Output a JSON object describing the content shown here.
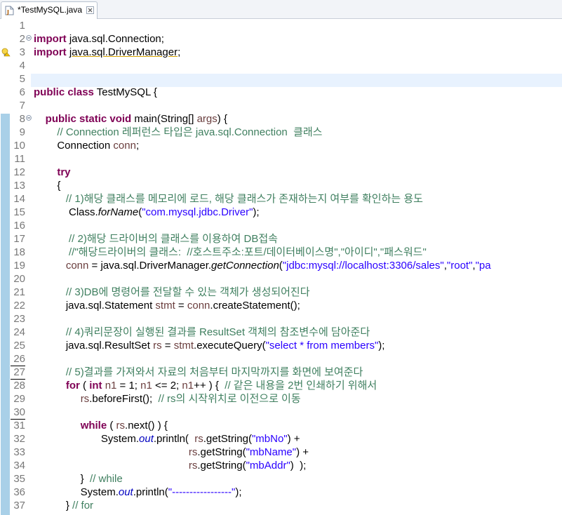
{
  "tab": {
    "label": "*TestMySQL.java",
    "icon": "java-file-icon",
    "close_icon": "close-icon"
  },
  "editor": {
    "lines": [
      {
        "no": "1"
      },
      {
        "no": "2",
        "fold": "minus",
        "segs": [
          [
            "kw",
            "import"
          ],
          [
            "n",
            " java.sql.Connection;"
          ]
        ]
      },
      {
        "no": "3",
        "warn": true,
        "segs": [
          [
            "kw",
            "import"
          ],
          [
            "n",
            " "
          ],
          [
            "ul",
            "java.sql.DriverManager"
          ],
          [
            "n",
            ";"
          ]
        ]
      },
      {
        "no": "4"
      },
      {
        "no": "5",
        "current": true
      },
      {
        "no": "6",
        "segs": [
          [
            "kw",
            "public"
          ],
          [
            "n",
            " "
          ],
          [
            "kw",
            "class"
          ],
          [
            "n",
            " TestMySQL {"
          ]
        ]
      },
      {
        "no": "7"
      },
      {
        "no": "8",
        "fold": "minus",
        "segs": [
          [
            "n",
            "    "
          ],
          [
            "kw",
            "public"
          ],
          [
            "n",
            " "
          ],
          [
            "kw",
            "static"
          ],
          [
            "n",
            " "
          ],
          [
            "kw",
            "void"
          ],
          [
            "n",
            " main(String[] "
          ],
          [
            "vr",
            "args"
          ],
          [
            "n",
            ") {"
          ]
        ]
      },
      {
        "no": "9",
        "segs": [
          [
            "n",
            "        "
          ],
          [
            "cm",
            "// Connection 레퍼런스 타입은 java.sql.Connection  클래스"
          ]
        ]
      },
      {
        "no": "10",
        "segs": [
          [
            "n",
            "        Connection "
          ],
          [
            "vr",
            "conn"
          ],
          [
            "n",
            ";"
          ]
        ]
      },
      {
        "no": "11"
      },
      {
        "no": "12",
        "segs": [
          [
            "n",
            "        "
          ],
          [
            "kw",
            "try"
          ]
        ]
      },
      {
        "no": "13",
        "segs": [
          [
            "n",
            "        {"
          ]
        ]
      },
      {
        "no": "14",
        "segs": [
          [
            "n",
            "           "
          ],
          [
            "cm",
            "// 1)해당 클래스를 메모리에 로드, 해당 클래스가 존재하는지 여부를 확인하는 용도"
          ]
        ]
      },
      {
        "no": "15",
        "segs": [
          [
            "n",
            "            Class."
          ],
          [
            "it",
            "forName"
          ],
          [
            "n",
            "("
          ],
          [
            "st",
            "\"com.mysql.jdbc.Driver\""
          ],
          [
            "n",
            ");"
          ]
        ]
      },
      {
        "no": "16"
      },
      {
        "no": "17",
        "segs": [
          [
            "n",
            "            "
          ],
          [
            "cm",
            "// 2)해당 드라이버의 클래스를 이용하여 DB접속"
          ]
        ]
      },
      {
        "no": "18",
        "segs": [
          [
            "n",
            "            "
          ],
          [
            "cm",
            "//\"해당드라이버의 클래스:  //호스트주소:포트/데이터베이스명\",\"아이디\",\"패스워드\""
          ]
        ]
      },
      {
        "no": "19",
        "segs": [
          [
            "n",
            "           "
          ],
          [
            "vr",
            "conn"
          ],
          [
            "n",
            " = java.sql.DriverManager."
          ],
          [
            "it",
            "getConnection"
          ],
          [
            "n",
            "("
          ],
          [
            "st",
            "\"jdbc:mysql://localhost:3306/sales\""
          ],
          [
            "n",
            ","
          ],
          [
            "st",
            "\"root\""
          ],
          [
            "n",
            ","
          ],
          [
            "st",
            "\"pa"
          ]
        ]
      },
      {
        "no": "20"
      },
      {
        "no": "21",
        "segs": [
          [
            "n",
            "           "
          ],
          [
            "cm",
            "// 3)DB에 명령어를 전달할 수 있는 객체가 생성되어진다"
          ]
        ]
      },
      {
        "no": "22",
        "segs": [
          [
            "n",
            "           java.sql.Statement "
          ],
          [
            "vr",
            "stmt"
          ],
          [
            "n",
            " = "
          ],
          [
            "vr",
            "conn"
          ],
          [
            "n",
            ".createStatement();"
          ]
        ]
      },
      {
        "no": "23"
      },
      {
        "no": "24",
        "segs": [
          [
            "n",
            "           "
          ],
          [
            "cm",
            "// 4)쿼리문장이 실행된 결과를 ResultSet 객체의 참조변수에 담아준다"
          ]
        ]
      },
      {
        "no": "25",
        "segs": [
          [
            "n",
            "           java.sql.ResultSet "
          ],
          [
            "vr",
            "rs"
          ],
          [
            "n",
            " = "
          ],
          [
            "vr",
            "stmt"
          ],
          [
            "n",
            ".executeQuery("
          ],
          [
            "st",
            "\"select * from members\""
          ],
          [
            "n",
            ");"
          ]
        ]
      },
      {
        "no": "26"
      },
      {
        "no": "27",
        "mark": true,
        "segs": [
          [
            "n",
            "           "
          ],
          [
            "cm",
            "// 5)결과를 가져와서 자료의 처음부터 마지막까지를 화면에 보여준다"
          ]
        ]
      },
      {
        "no": "28",
        "mark": true,
        "segs": [
          [
            "n",
            "           "
          ],
          [
            "kw",
            "for"
          ],
          [
            "n",
            " ( "
          ],
          [
            "kw",
            "int"
          ],
          [
            "n",
            " "
          ],
          [
            "vr",
            "n1"
          ],
          [
            "n",
            " = 1; "
          ],
          [
            "vr",
            "n1"
          ],
          [
            "n",
            " <= 2; "
          ],
          [
            "vr",
            "n1"
          ],
          [
            "n",
            "++ ) {  "
          ],
          [
            "cm",
            "// 같은 내용을 2번 인쇄하기 위해서"
          ]
        ]
      },
      {
        "no": "29",
        "segs": [
          [
            "n",
            "                "
          ],
          [
            "vr",
            "rs"
          ],
          [
            "n",
            ".beforeFirst();  "
          ],
          [
            "cm",
            "// rs의 시작위치로 이전으로 이동"
          ]
        ]
      },
      {
        "no": "30"
      },
      {
        "no": "31",
        "mark": true,
        "segs": [
          [
            "n",
            "                "
          ],
          [
            "kw",
            "while"
          ],
          [
            "n",
            " ( "
          ],
          [
            "vr",
            "rs"
          ],
          [
            "n",
            ".next() ) {"
          ]
        ]
      },
      {
        "no": "32",
        "segs": [
          [
            "n",
            "                       System."
          ],
          [
            "fd",
            "out"
          ],
          [
            "n",
            ".println(  "
          ],
          [
            "vr",
            "rs"
          ],
          [
            "n",
            ".getString("
          ],
          [
            "st",
            "\"mbNo\""
          ],
          [
            "n",
            ") +"
          ]
        ]
      },
      {
        "no": "33",
        "segs": [
          [
            "n",
            "                                                     "
          ],
          [
            "vr",
            "rs"
          ],
          [
            "n",
            ".getString("
          ],
          [
            "st",
            "\"mbName\""
          ],
          [
            "n",
            ") +"
          ]
        ]
      },
      {
        "no": "34",
        "segs": [
          [
            "n",
            "                                                     "
          ],
          [
            "vr",
            "rs"
          ],
          [
            "n",
            ".getString("
          ],
          [
            "st",
            "\"mbAddr\""
          ],
          [
            "n",
            ")  );"
          ]
        ]
      },
      {
        "no": "35",
        "segs": [
          [
            "n",
            "                }  "
          ],
          [
            "cm",
            "// while"
          ]
        ]
      },
      {
        "no": "36",
        "segs": [
          [
            "n",
            "                System."
          ],
          [
            "fd",
            "out"
          ],
          [
            "n",
            ".println("
          ],
          [
            "st",
            "\"-----------------\""
          ],
          [
            "n",
            ");"
          ]
        ]
      },
      {
        "no": "37",
        "segs": [
          [
            "n",
            "           } "
          ],
          [
            "cm",
            "// for"
          ]
        ]
      }
    ]
  },
  "colors": {
    "keyword": "#7f0055",
    "comment": "#3f7f5f",
    "string": "#2a00ff",
    "field": "#0000c0",
    "current_line": "#e8f2fe",
    "range": "#a9d0e8"
  }
}
